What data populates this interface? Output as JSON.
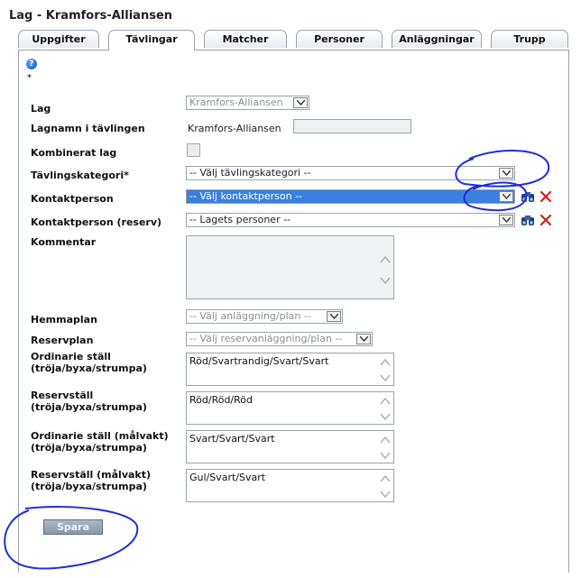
{
  "page": {
    "title": "Lag - Kramfors-Alliansen"
  },
  "tabs": [
    {
      "label": "Uppgifter",
      "active": false
    },
    {
      "label": "Tävlingar",
      "active": true
    },
    {
      "label": "Matcher",
      "active": false
    },
    {
      "label": "Personer",
      "active": false
    },
    {
      "label": "Anläggningar",
      "active": false
    },
    {
      "label": "Trupp",
      "active": false
    }
  ],
  "form": {
    "required_marker": "*",
    "lag": {
      "label": "Lag",
      "value": "Kramfors-Alliansen"
    },
    "lagnamn": {
      "label": "Lagnamn i tävlingen",
      "value": "Kramfors-Alliansen"
    },
    "kombinerat": {
      "label": "Kombinerat lag",
      "checked": false
    },
    "tavlingskategori": {
      "label": "Tävlingskategori*",
      "value": "-- Välj tävlingskategori --"
    },
    "kontaktperson": {
      "label": "Kontaktperson",
      "value": "-- Välj kontaktperson --"
    },
    "kontaktperson_reserv": {
      "label": "Kontaktperson (reserv)",
      "value": "-- Lagets personer --"
    },
    "kommentar": {
      "label": "Kommentar",
      "value": ""
    },
    "hemmaplan": {
      "label": "Hemmaplan",
      "value": "-- Välj anläggning/plan --"
    },
    "reservplan": {
      "label": "Reservplan",
      "value": "-- Välj reservanläggning/plan --"
    },
    "ordinarie_stall": {
      "label_1": "Ordinarie ställ",
      "label_2": "(tröja/byxa/strumpa)",
      "value": "Röd/Svartrandig/Svart/Svart"
    },
    "reservstall": {
      "label_1": "Reservställ",
      "label_2": "(tröja/byxa/strumpa)",
      "value": "Röd/Röd/Röd"
    },
    "ordinarie_malvakt": {
      "label_1": "Ordinarie ställ (målvakt)",
      "label_2": "(tröja/byxa/strumpa)",
      "value": "Svart/Svart/Svart"
    },
    "reserv_malvakt": {
      "label_1": "Reservställ (målvakt)",
      "label_2": "(tröja/byxa/strumpa)",
      "value": "Gul/Svart/Svart"
    }
  },
  "buttons": {
    "save": "Spara"
  },
  "colors": {
    "highlight": "#3b7fe0",
    "annotation": "#1f2fd6",
    "delete": "#d21e1e"
  },
  "icons": {
    "help": "help-icon",
    "search": "binoculars-icon",
    "delete": "red-x-icon"
  }
}
